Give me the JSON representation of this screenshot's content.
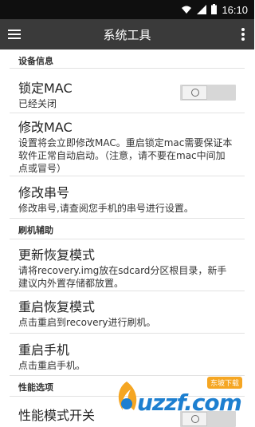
{
  "status_bar": {
    "time": "16:10"
  },
  "app_bar": {
    "title": "系统工具"
  },
  "sections": {
    "device_info": "设备信息",
    "flash_assist": "刷机辅助",
    "performance": "性能选项"
  },
  "items": {
    "lock_mac": {
      "title": "锁定MAC",
      "subtitle": "已经关闭",
      "toggle_on": false
    },
    "modify_mac": {
      "title": "修改MAC",
      "subtitle": "设置将会立即修改MAC。重启锁定mac需要保证本软件正常自动启动。（注意，请不要在mac中间加点或冒号）"
    },
    "modify_serial": {
      "title": "修改串号",
      "subtitle": "修改串号,请查阅您手机的串号进行设置。"
    },
    "update_recovery": {
      "title": "更新恢复模式",
      "subtitle": "请将recovery.img放在sdcard分区根目录，新手建议内外置存储都放置。"
    },
    "reboot_recovery": {
      "title": "重启恢复模式",
      "subtitle": "点击重启到recovery进行刷机。"
    },
    "reboot_phone": {
      "title": "重启手机",
      "subtitle": "点击重启手机。"
    },
    "performance_mode": {
      "title": "性能模式开关",
      "toggle_on": false
    }
  },
  "watermark": {
    "brand": "uzzf.com",
    "badge": "东坡下载"
  },
  "colors": {
    "status_bar": "#0f0f0f",
    "app_bar": "#3a3a3a",
    "watermark": "#1d7fd0",
    "badge": "#f5a623"
  }
}
